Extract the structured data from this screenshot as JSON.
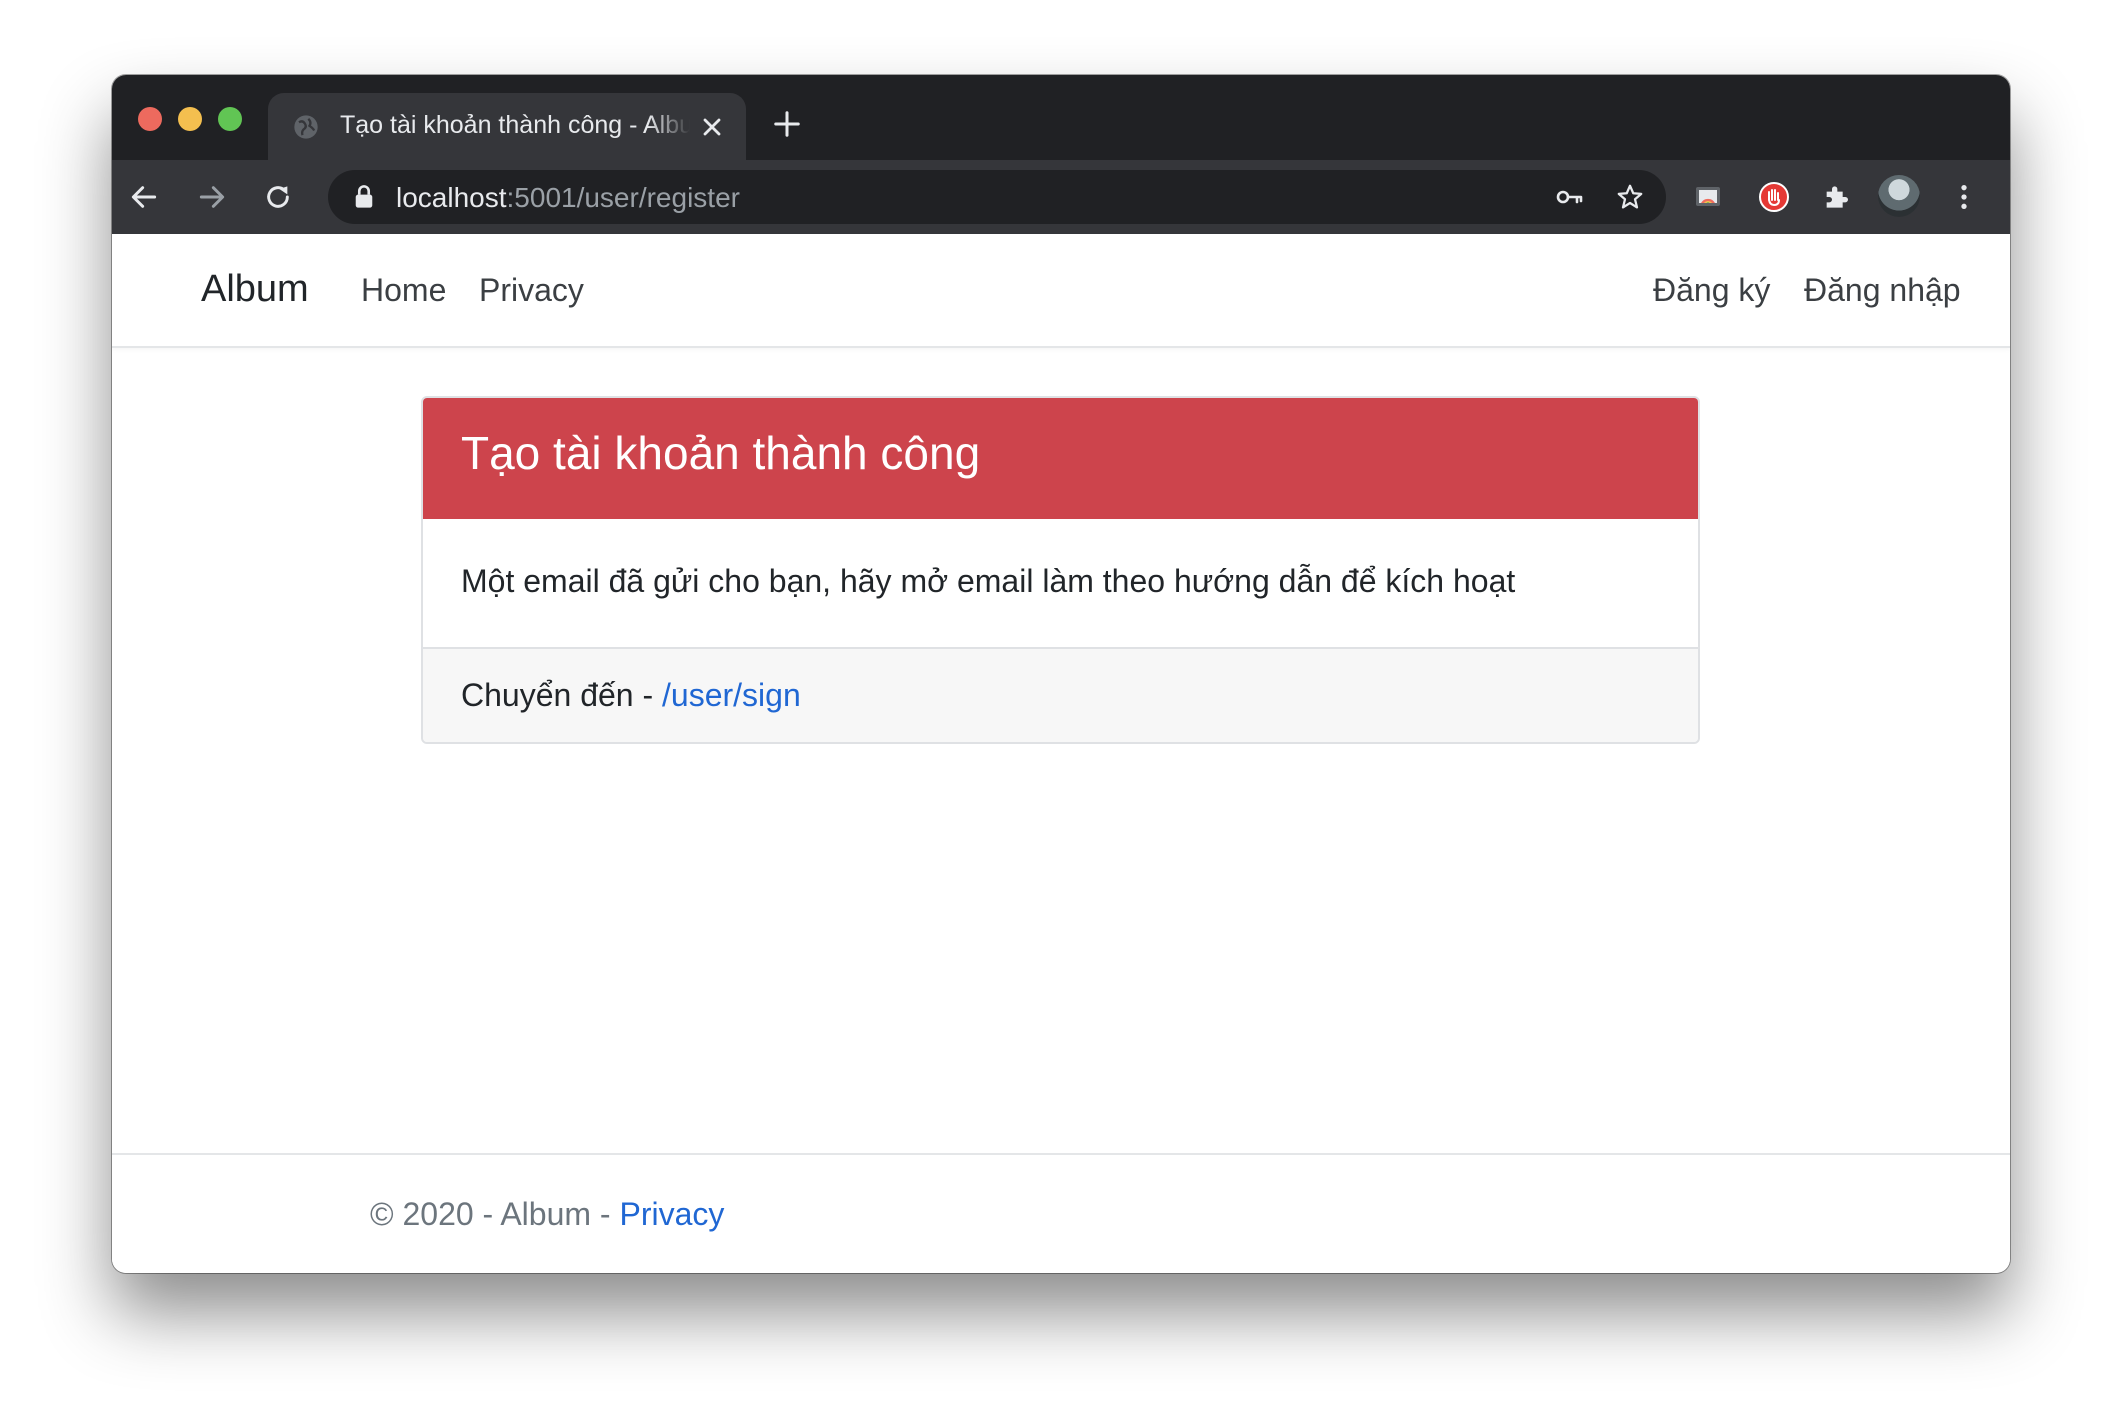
{
  "browser": {
    "tab_title": "Tạo tài khoản thành công - Album",
    "url_host": "localhost",
    "url_rest": ":5001/user/register",
    "icons": [
      "back-icon",
      "forward-icon",
      "reload-icon",
      "lock-icon",
      "key-icon",
      "star-icon",
      "cast-icon",
      "stop-extension-icon",
      "extensions-icon",
      "avatar",
      "menu-icon"
    ]
  },
  "nav": {
    "brand": "Album",
    "links": [
      "Home",
      "Privacy"
    ],
    "right_links": [
      "Đăng ký",
      "Đăng nhập"
    ]
  },
  "card": {
    "title": "Tạo tài khoản thành công",
    "body": "Một email đã gửi cho bạn, hãy mở email làm theo hướng dẫn để kích hoạt",
    "footer_prefix": "Chuyển đến - ",
    "footer_link": "/user/sign",
    "header_color": "#cd444c"
  },
  "footer": {
    "text": "© 2020 - Album - ",
    "link": "Privacy"
  },
  "colors": {
    "link": "#2067d3",
    "chrome_dark": "#202124",
    "chrome_toolbar": "#35363a"
  }
}
